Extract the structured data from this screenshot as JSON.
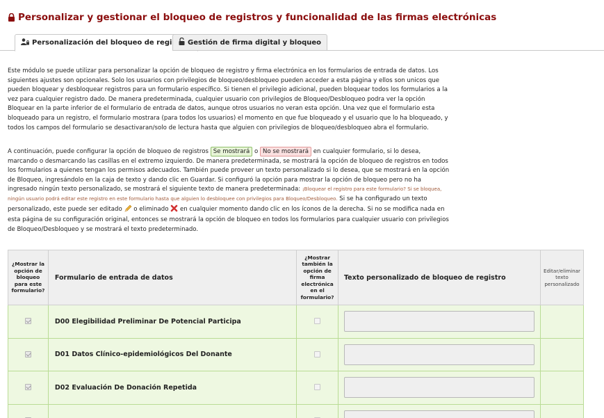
{
  "header": {
    "title": "Personalizar y gestionar el bloqueo de registros y funcionalidad de las firmas electrónicas",
    "icon": "lock-icon",
    "accent": "#8b0e0e"
  },
  "tabs": [
    {
      "label": "Personalización del bloqueo de registros",
      "icon": "user-lock-icon",
      "active": true
    },
    {
      "label": "Gestión de firma digital y bloqueo",
      "icon": "unlock-icon",
      "active": false
    }
  ],
  "intro": {
    "text": "Este módulo se puede utilizar para personalizar la opción de bloqueo de registro y firma electrónica en los formularios de entrada de datos. Los siguientes ajustes son opcionales. Solo los usuarios con privilegios de bloqueo/desbloqueo pueden acceder a esta página y ellos son unicos que pueden bloquear y desbloquear registros para un formulario específico. Si tienen el privilegio adicional, pueden bloquear todos los formularios a la vez para cualquier registro dado. De manera predeterminada, cualquier usuario con privilegios de Bloqueo/Desbloqueo podra ver la opción Bloquear en la parte inferior de el formulario de entrada de datos, aunque otros usuarios no veran esta opción. Una vez que el formulario esta bloqueado para un registro, el formulario mostrara (para todos los usuarios) el momento en que fue bloqueado y el usuario que lo ha bloqueado, y todos los campos del formulario se desactivaran/solo de lectura hasta que alguien con privilegios de bloqueo/desbloqueo abra el formulario."
  },
  "config": {
    "part1": "A continuación, puede configurar la opción de bloqueo de registros",
    "show_label": "Se mostrará",
    "or": "o",
    "hide_label": "No se mostrará",
    "part2": "en cualquier formulario, si lo desea, marcando o desmarcando las casillas en el extremo izquierdo. De manera predeterminada, se mostrará la opción de bloqueo de registros en todos los formularios a quienes tengan los permisos adecuados. También puede proveer un texto personalizado si lo desea, que se mostrará en la opción de Bloqueo, ingresándolo en la caja de texto y dando clic en Guardar. Si configuró la opción para mostrar la opción de bloqueo pero no ha ingresado ningún texto personalizado, se mostrará el siguiente texto de manera predeterminada:",
    "default_message": "¡Bloquear el registro para este formulario? Si se bloquea, ningún usuario podrá editar este registro en este formulario hasta que alguien lo desbloquee con privilegios para Bloqueo/Desbloqueo.",
    "part3": "Si se ha configurado un texto personalizado, este puede ser editado",
    "part4": "o eliminado",
    "part5": "en cualquier momento dando clic en los íconos de la derecha. Si no se modifica nada en esta página de su configuración original, entonces se mostrará la opción de bloqueo en todos los formularios para cualquier usuario con privilegios de Bloqueo/Desbloqueo y se mostrará el texto predeterminado."
  },
  "table": {
    "headers": {
      "show_lock": "¿Mostrar la opción de bloqueo para este formulario?",
      "form": "Formulario de entrada de datos",
      "show_esign": "¿Mostrar también la opción de firma electrónica en el formulario?",
      "custom_text": "Texto personalizado de bloqueo de registro",
      "edit_delete": "Editar/eliminar texto personalizado"
    },
    "rows": [
      {
        "form": "D00 Elegibilidad Preliminar De Potencial Participa",
        "show_lock": true,
        "show_esign": false,
        "custom_text": ""
      },
      {
        "form": "D01 Datos Clínico-epidemiológicos Del Donante",
        "show_lock": true,
        "show_esign": false,
        "custom_text": ""
      },
      {
        "form": "D02 Evaluación De Donación Repetida",
        "show_lock": true,
        "show_esign": false,
        "custom_text": ""
      }
    ]
  }
}
